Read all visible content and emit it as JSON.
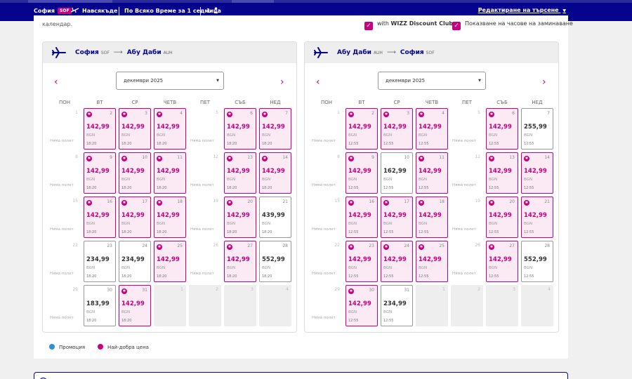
{
  "topbar": {
    "origin": "София",
    "origin_code": "SOF",
    "direction": "Навсякъде",
    "date_range": "По Всяко Време за 1 седмица",
    "passengers": "1",
    "edit_search": "Редактиране на търсене"
  },
  "card": {
    "label": "календар.",
    "option_discount_prefix": "with ",
    "option_discount_brand": "WIZZ Discount Club",
    "option_show_times": "Показване на часове на заминаване"
  },
  "colors": {
    "brand_navy": "#06038d",
    "brand_pink": "#c6007e",
    "promo_blue": "#2b8fd9"
  },
  "weekdays": [
    "ПОН",
    "ВТ",
    "СР",
    "ЧЕТВ",
    "ПЕТ",
    "СЪБ",
    "НЕД"
  ],
  "no_flight": "Няма полет",
  "currency": "BGN",
  "outbound": {
    "from": "София",
    "from_code": "SOF",
    "to": "Абу Даби",
    "to_code": "AUH",
    "month": "декември 2025",
    "time": "18:20",
    "days": [
      {
        "d": "1",
        "t": "empty"
      },
      {
        "d": "2",
        "t": "best",
        "p": "142,99"
      },
      {
        "d": "3",
        "t": "best",
        "p": "142,99"
      },
      {
        "d": "4",
        "t": "best",
        "p": "142,99"
      },
      {
        "d": "5",
        "t": "empty"
      },
      {
        "d": "6",
        "t": "best",
        "p": "142,99"
      },
      {
        "d": "7",
        "t": "best",
        "p": "142,99"
      },
      {
        "d": "8",
        "t": "empty"
      },
      {
        "d": "9",
        "t": "best",
        "p": "142,99"
      },
      {
        "d": "10",
        "t": "best",
        "p": "142,99"
      },
      {
        "d": "11",
        "t": "best",
        "p": "142,99"
      },
      {
        "d": "12",
        "t": "empty"
      },
      {
        "d": "13",
        "t": "best",
        "p": "142,99"
      },
      {
        "d": "14",
        "t": "best",
        "p": "142,99"
      },
      {
        "d": "15",
        "t": "empty"
      },
      {
        "d": "16",
        "t": "best",
        "p": "142,99"
      },
      {
        "d": "17",
        "t": "best",
        "p": "142,99"
      },
      {
        "d": "18",
        "t": "best",
        "p": "142,99"
      },
      {
        "d": "19",
        "t": "empty"
      },
      {
        "d": "20",
        "t": "best",
        "p": "142,99"
      },
      {
        "d": "21",
        "t": "norm",
        "p": "439,99"
      },
      {
        "d": "22",
        "t": "empty"
      },
      {
        "d": "23",
        "t": "norm",
        "p": "234,99"
      },
      {
        "d": "24",
        "t": "norm",
        "p": "234,99"
      },
      {
        "d": "25",
        "t": "best",
        "p": "142,99"
      },
      {
        "d": "26",
        "t": "empty"
      },
      {
        "d": "27",
        "t": "best",
        "p": "142,99"
      },
      {
        "d": "28",
        "t": "norm",
        "p": "552,99"
      },
      {
        "d": "29",
        "t": "empty"
      },
      {
        "d": "30",
        "t": "norm",
        "p": "183,99"
      },
      {
        "d": "31",
        "t": "best",
        "p": "142,99"
      },
      {
        "d": "1",
        "t": "dis"
      },
      {
        "d": "2",
        "t": "dis"
      },
      {
        "d": "3",
        "t": "dis"
      },
      {
        "d": "4",
        "t": "dis"
      }
    ]
  },
  "inbound": {
    "from": "Абу Даби",
    "from_code": "AUH",
    "to": "София",
    "to_code": "SOF",
    "month": "декември 2025",
    "time": "12:55",
    "days": [
      {
        "d": "1",
        "t": "empty"
      },
      {
        "d": "2",
        "t": "best",
        "p": "142,99"
      },
      {
        "d": "3",
        "t": "best",
        "p": "142,99"
      },
      {
        "d": "4",
        "t": "best",
        "p": "142,99"
      },
      {
        "d": "5",
        "t": "empty"
      },
      {
        "d": "6",
        "t": "best",
        "p": "142,99"
      },
      {
        "d": "7",
        "t": "norm",
        "p": "255,99"
      },
      {
        "d": "8",
        "t": "empty"
      },
      {
        "d": "9",
        "t": "best",
        "p": "142,99"
      },
      {
        "d": "10",
        "t": "norm",
        "p": "162,99"
      },
      {
        "d": "11",
        "t": "best",
        "p": "142,99"
      },
      {
        "d": "12",
        "t": "empty"
      },
      {
        "d": "13",
        "t": "best",
        "p": "142,99"
      },
      {
        "d": "14",
        "t": "best",
        "p": "142,99"
      },
      {
        "d": "15",
        "t": "empty"
      },
      {
        "d": "16",
        "t": "best",
        "p": "142,99"
      },
      {
        "d": "17",
        "t": "best",
        "p": "142,99"
      },
      {
        "d": "18",
        "t": "best",
        "p": "142,99"
      },
      {
        "d": "19",
        "t": "empty"
      },
      {
        "d": "20",
        "t": "best",
        "p": "142,99"
      },
      {
        "d": "21",
        "t": "best",
        "p": "142,99"
      },
      {
        "d": "22",
        "t": "empty"
      },
      {
        "d": "23",
        "t": "best",
        "p": "142,99"
      },
      {
        "d": "24",
        "t": "best",
        "p": "142,99"
      },
      {
        "d": "25",
        "t": "best",
        "p": "142,99"
      },
      {
        "d": "26",
        "t": "empty"
      },
      {
        "d": "27",
        "t": "best",
        "p": "142,99"
      },
      {
        "d": "28",
        "t": "norm",
        "p": "552,99"
      },
      {
        "d": "29",
        "t": "empty"
      },
      {
        "d": "30",
        "t": "best",
        "p": "142,99"
      },
      {
        "d": "31",
        "t": "norm",
        "p": "234,99"
      },
      {
        "d": "1",
        "t": "dis"
      },
      {
        "d": "2",
        "t": "dis"
      },
      {
        "d": "3",
        "t": "dis"
      },
      {
        "d": "4",
        "t": "dis"
      }
    ]
  },
  "legend": {
    "promo": "Промоция",
    "best": "Най-добра цена"
  }
}
